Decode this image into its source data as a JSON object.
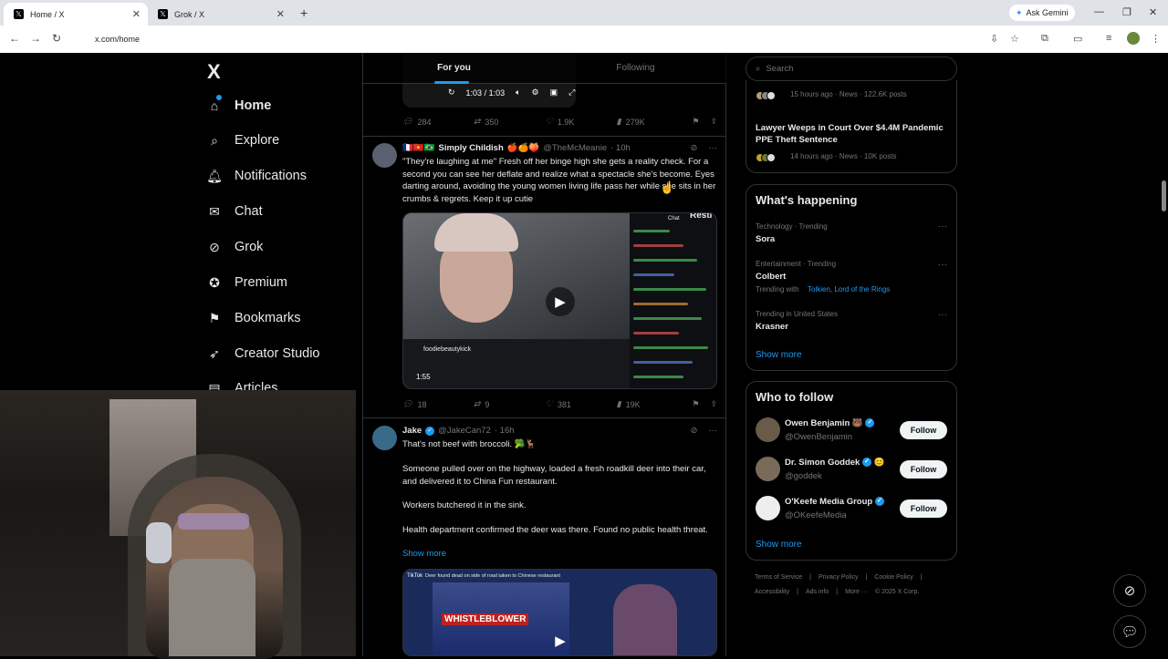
{
  "browser": {
    "tabs": [
      {
        "label": "Home / X"
      },
      {
        "label": "Grok / X"
      }
    ],
    "new_tab": "+",
    "ask_gemini": "Ask Gemini",
    "url": "x.com/home"
  },
  "nav": {
    "logo": "X",
    "items": [
      {
        "label": "Home"
      },
      {
        "label": "Explore"
      },
      {
        "label": "Notifications"
      },
      {
        "label": "Chat"
      },
      {
        "label": "Grok"
      },
      {
        "label": "Premium"
      },
      {
        "label": "Bookmarks"
      },
      {
        "label": "Creator Studio"
      },
      {
        "label": "Articles"
      }
    ]
  },
  "feed": {
    "tabs": [
      "For you",
      "Following"
    ],
    "top_video": {
      "time": "1:03 / 1:03"
    },
    "post0_actions": {
      "replies": "284",
      "reposts": "350",
      "likes": "1.9K",
      "views": "279K"
    },
    "post1": {
      "name": "Simply Childish",
      "handle": "@TheMcMeanie",
      "time": "· 10h",
      "flags": "🇫🇷🇻🇳🇧🇷",
      "emojis": "🍎🍊🍑",
      "text": "\"They're laughing at me\" Fresh off her binge high she gets a reality check. For a second you can see her deflate and realize what a spectacle she's become. Eyes darting around, avoiding the young women living life pass her while she sits in her crumbs & regrets. Keep it up cutie",
      "video": {
        "streamer": "foodiebeautykick",
        "duration": "1:55",
        "chat_label": "Chat",
        "corner_text": "Resti"
      },
      "actions": {
        "replies": "18",
        "reposts": "9",
        "likes": "381",
        "views": "19K"
      }
    },
    "post2": {
      "name": "Jake",
      "handle": "@JakeCan72",
      "time": "· 16h",
      "line1": "That's not beef with broccoli. 🥦🦌",
      "line2": "Someone pulled over on the highway, loaded a fresh roadkill deer into their car, and delivered it to China Fun restaurant.",
      "line3": "Workers butchered it in the sink.",
      "line4": "Health department confirmed the deer was there. Found no public health threat.",
      "show_more": "Show more",
      "video": {
        "caption": "Deer found dead on side of road taken to Chinese restaurant",
        "banner": "WHISTLEBLOWER",
        "source": "TikTok"
      }
    }
  },
  "sidebar": {
    "search_placeholder": "Search",
    "news_top": {
      "meta": "15 hours ago · News · 122.6K posts"
    },
    "news2": {
      "title": "Lawyer Weeps in Court Over $4.4M Pandemic PPE Theft Sentence",
      "meta": "14 hours ago · News · 10K posts"
    },
    "happening": {
      "title": "What's happening",
      "trends": [
        {
          "context": "Technology · Trending",
          "name": "Sora",
          "with": ""
        },
        {
          "context": "Entertainment · Trending",
          "name": "Colbert",
          "with_label": "Trending with",
          "with": "Tolkien, Lord of the Rings"
        },
        {
          "context": "Trending in United States",
          "name": "Krasner",
          "with": ""
        }
      ],
      "show_more": "Show more"
    },
    "follow": {
      "title": "Who to follow",
      "people": [
        {
          "name": "Owen Benjamin",
          "extra": "🐻",
          "handle": "@OwenBenjamin",
          "button": "Follow"
        },
        {
          "name": "Dr. Simon Goddek",
          "extra": "😊",
          "handle": "@goddek",
          "button": "Follow"
        },
        {
          "name": "O'Keefe Media Group",
          "extra": "",
          "handle": "@OKeefeMedia",
          "button": "Follow"
        }
      ],
      "show_more": "Show more"
    },
    "footer": {
      "row1": [
        "Terms of Service",
        "Privacy Policy",
        "Cookie Policy"
      ],
      "row2": [
        "Accessibility",
        "Ads info",
        "More ···",
        "© 2025 X Corp."
      ]
    }
  },
  "colors": {
    "accent": "#1d9bf0",
    "bg": "#000000",
    "border": "#2f3336",
    "muted": "#71767b"
  }
}
